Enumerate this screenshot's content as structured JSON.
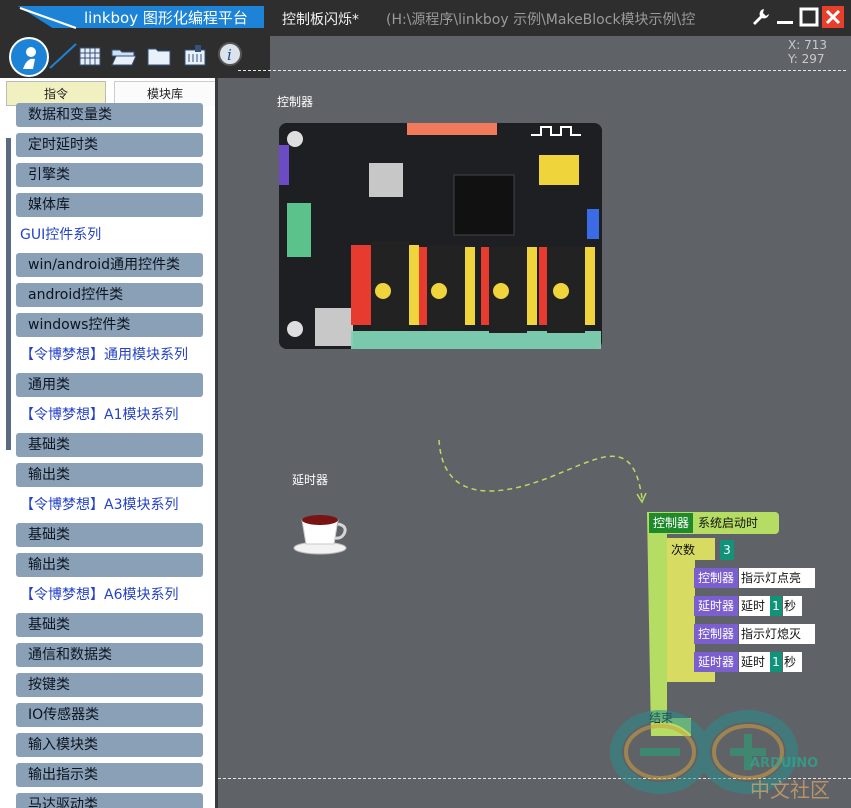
{
  "titlebar": {
    "app_title": "linkboy 图形化编程平台",
    "doc_title": "控制板闪烁*",
    "doc_path": "(H:\\源程序\\linkboy 示例\\MakeBlock模块示例\\控"
  },
  "toolbar": {
    "icons": [
      "logo-icon",
      "grid-icon",
      "open-folder-icon",
      "folder-icon",
      "module-icon",
      "info-icon"
    ]
  },
  "coords": {
    "x": "X: 713",
    "y": "Y: 297"
  },
  "left_panel": {
    "tabs": [
      {
        "label": "指令"
      },
      {
        "label": "模块库"
      }
    ],
    "items": [
      {
        "label": "数据和变量类",
        "kind": "item"
      },
      {
        "label": "定时延时类",
        "kind": "item"
      },
      {
        "label": "引擎类",
        "kind": "item"
      },
      {
        "label": "媒体库",
        "kind": "item"
      },
      {
        "label": "GUI控件系列",
        "kind": "group"
      },
      {
        "label": "win/android通用控件类",
        "kind": "item"
      },
      {
        "label": "android控件类",
        "kind": "item"
      },
      {
        "label": "windows控件类",
        "kind": "item"
      },
      {
        "label": "【令博梦想】通用模块系列",
        "kind": "group"
      },
      {
        "label": "通用类",
        "kind": "item"
      },
      {
        "label": "【令博梦想】A1模块系列",
        "kind": "group"
      },
      {
        "label": "基础类",
        "kind": "item"
      },
      {
        "label": "输出类",
        "kind": "item"
      },
      {
        "label": "【令博梦想】A3模块系列",
        "kind": "group"
      },
      {
        "label": "基础类",
        "kind": "item"
      },
      {
        "label": "输出类",
        "kind": "item"
      },
      {
        "label": "【令博梦想】A6模块系列",
        "kind": "group"
      },
      {
        "label": "基础类",
        "kind": "item"
      },
      {
        "label": "通信和数据类",
        "kind": "item"
      },
      {
        "label": "按键类",
        "kind": "item"
      },
      {
        "label": "IO传感器类",
        "kind": "item"
      },
      {
        "label": "输入模块类",
        "kind": "item"
      },
      {
        "label": "输出指示类",
        "kind": "item"
      },
      {
        "label": "马达驱动类",
        "kind": "item"
      }
    ]
  },
  "canvas": {
    "controller_label": "控制器",
    "timer_label": "延时器",
    "program": {
      "event_tag": "控制器",
      "event_text": "系统启动时",
      "loop_label": "次数",
      "loop_count": "3",
      "statements": [
        {
          "tag": "控制器",
          "text": "指示灯点亮"
        },
        {
          "tag": "延时器",
          "text": "延时",
          "value": "1",
          "unit": "秒"
        },
        {
          "tag": "控制器",
          "text": "指示灯熄灭"
        },
        {
          "tag": "延时器",
          "text": "延时",
          "value": "1",
          "unit": "秒"
        }
      ],
      "end_label": "结束"
    },
    "watermark": {
      "line1": "ARDUINO",
      "line2": "中文社区"
    }
  },
  "colors": {
    "title_blue": "#1c83d6",
    "panel_item": "#8aa0b6",
    "group_text": "#2542c8",
    "block_green": "#b3d96b",
    "block_yellow": "#d8db62",
    "tag_purple": "#7b5fd0",
    "num_teal": "#11937a",
    "close_red": "#e6402c"
  }
}
